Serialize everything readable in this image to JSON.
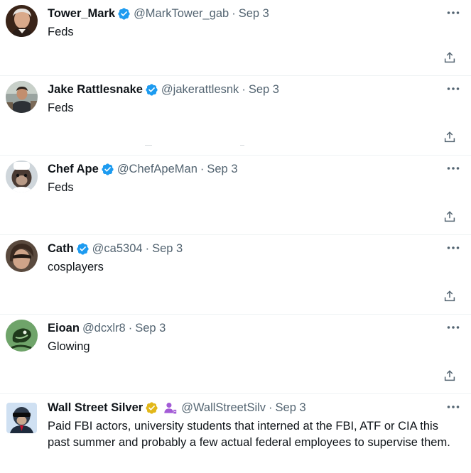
{
  "tweets": [
    {
      "name": "Tower_Mark",
      "verified": "blue",
      "handle": "@MarkTower_gab",
      "separator": "·",
      "time": "Sep 3",
      "text": "Feds",
      "avatar_icon": "portrait-avatar",
      "more_icon": "more-options-icon",
      "share_icon": "share-icon"
    },
    {
      "name": "Jake Rattlesnake",
      "verified": "blue",
      "handle": "@jakerattlesnk",
      "separator": "·",
      "time": "Sep 3",
      "text": "Feds",
      "avatar_icon": "person-avatar",
      "more_icon": "more-options-icon",
      "share_icon": "share-icon"
    },
    {
      "name": "Chef Ape",
      "verified": "blue",
      "handle": "@ChefApeMan",
      "separator": "·",
      "time": "Sep 3",
      "text": "Feds",
      "avatar_icon": "ape-avatar",
      "more_icon": "more-options-icon",
      "share_icon": "share-icon"
    },
    {
      "name": "Cath",
      "verified": "blue",
      "handle": "@ca5304",
      "separator": "·",
      "time": "Sep 3",
      "text": "cosplayers",
      "avatar_icon": "selfie-avatar",
      "more_icon": "more-options-icon",
      "share_icon": "share-icon"
    },
    {
      "name": "Eioan",
      "verified": "none",
      "handle": "@dcxlr8",
      "separator": "·",
      "time": "Sep 3",
      "text": "Glowing",
      "avatar_icon": "frog-avatar",
      "more_icon": "more-options-icon",
      "share_icon": "share-icon"
    },
    {
      "name": "Wall Street Silver",
      "verified": "gold",
      "affiliate_icon": "affiliate-person-icon",
      "handle": "@WallStreetSilv",
      "separator": "·",
      "time": "Sep 3",
      "text": "Paid FBI actors, university students that interned at the FBI, ATF or CIA this past summer and probably a few actual federal employees to supervise them.",
      "avatar_icon": "ape-sunglasses-avatar",
      "more_icon": "more-options-icon"
    }
  ],
  "colors": {
    "verified_blue": "#1d9bf0",
    "verified_gold": "#e2b719",
    "affiliate_purple": "#a35bd6",
    "secondary_text": "#536471",
    "primary_text": "#0f1419",
    "divider": "#eff3f4"
  }
}
